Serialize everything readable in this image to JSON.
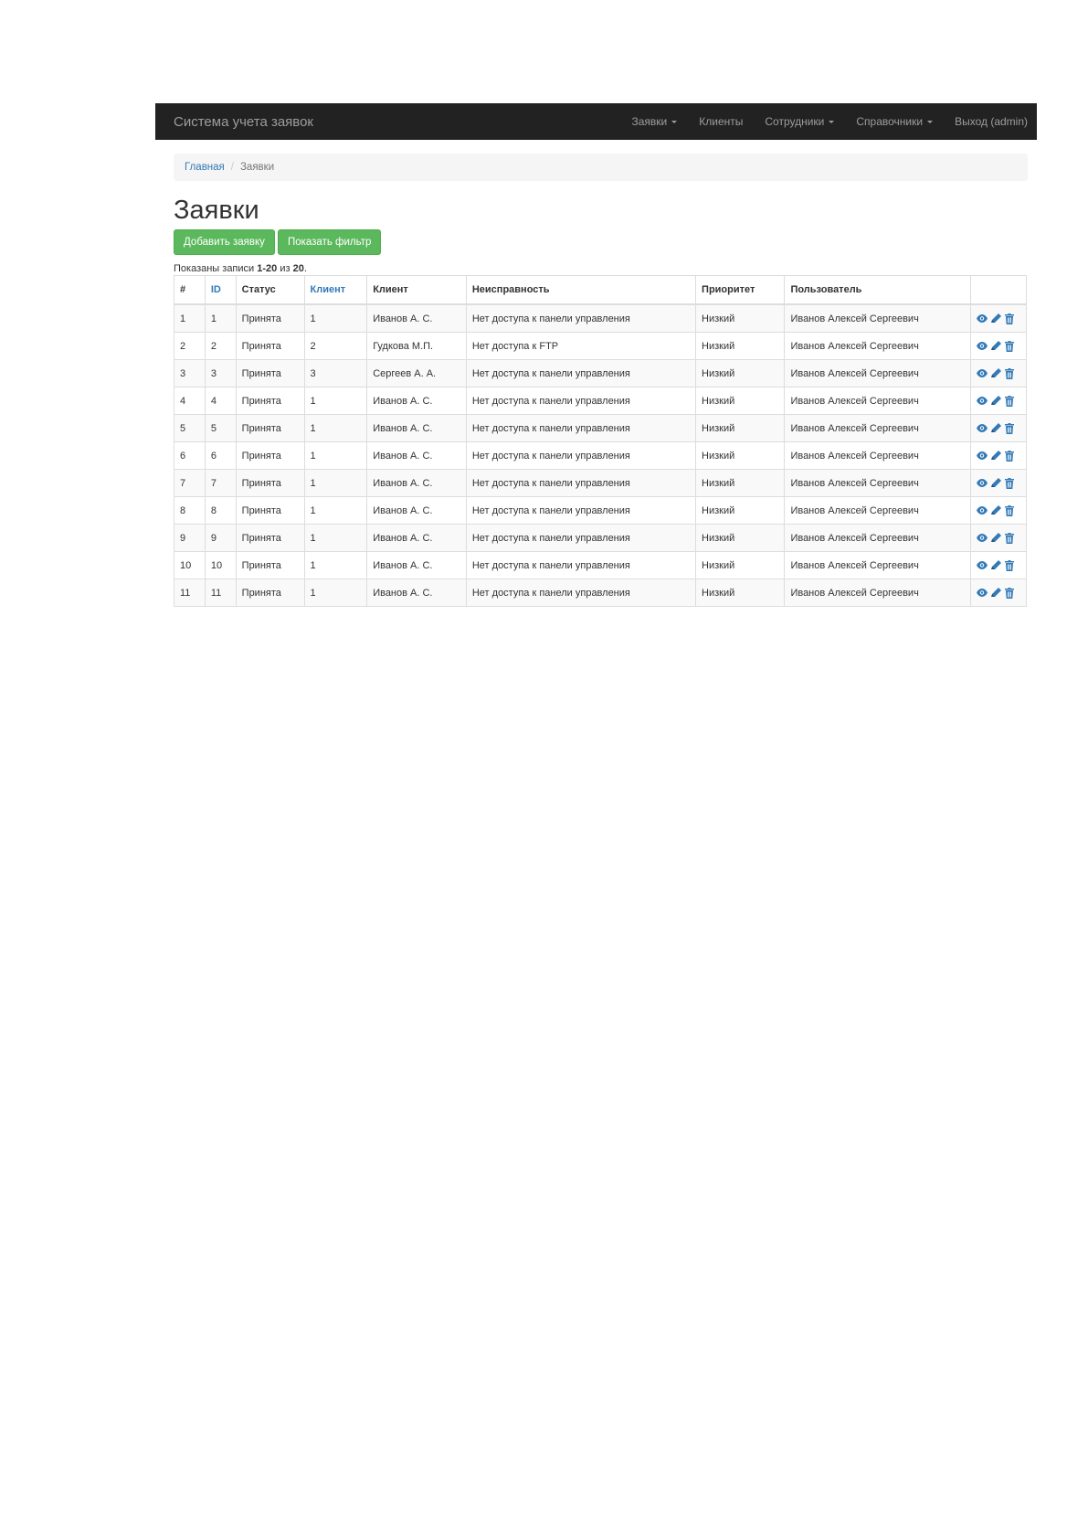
{
  "navbar": {
    "brand": "Система учета заявок",
    "items": [
      {
        "label": "Заявки",
        "dropdown": true
      },
      {
        "label": "Клиенты",
        "dropdown": false
      },
      {
        "label": "Сотрудники",
        "dropdown": true
      },
      {
        "label": "Справочники",
        "dropdown": true
      },
      {
        "label": "Выход (admin)",
        "dropdown": false
      }
    ]
  },
  "breadcrumb": {
    "home": "Главная",
    "separator": "/",
    "current": "Заявки"
  },
  "page": {
    "title": "Заявки",
    "add_button": "Добавить заявку",
    "filter_button": "Показать фильтр",
    "summary_prefix": "Показаны записи ",
    "summary_range": "1-20",
    "summary_mid": " из ",
    "summary_total": "20",
    "summary_end": "."
  },
  "table": {
    "columns": [
      {
        "label": "#",
        "sortable": false
      },
      {
        "label": "ID",
        "sortable": true
      },
      {
        "label": "Статус",
        "sortable": false
      },
      {
        "label": "Клиент",
        "sortable": true
      },
      {
        "label": "Клиент",
        "sortable": false
      },
      {
        "label": "Неисправность",
        "sortable": false
      },
      {
        "label": "Приоритет",
        "sortable": false
      },
      {
        "label": "Пользователь",
        "sortable": false
      },
      {
        "label": "",
        "sortable": false
      }
    ],
    "rows": [
      [
        "1",
        "1",
        "Принята",
        "1",
        "Иванов А. С.",
        "Нет доступа к панели управления",
        "Низкий",
        "Иванов Алексей Сергеевич"
      ],
      [
        "2",
        "2",
        "Принята",
        "2",
        "Гудкова М.П.",
        "Нет доступа к FTP",
        "Низкий",
        "Иванов Алексей Сергеевич"
      ],
      [
        "3",
        "3",
        "Принята",
        "3",
        "Сергеев А. А.",
        "Нет доступа к панели управления",
        "Низкий",
        "Иванов Алексей Сергеевич"
      ],
      [
        "4",
        "4",
        "Принята",
        "1",
        "Иванов А. С.",
        "Нет доступа к панели управления",
        "Низкий",
        "Иванов Алексей Сергеевич"
      ],
      [
        "5",
        "5",
        "Принята",
        "1",
        "Иванов А. С.",
        "Нет доступа к панели управления",
        "Низкий",
        "Иванов Алексей Сергеевич"
      ],
      [
        "6",
        "6",
        "Принята",
        "1",
        "Иванов А. С.",
        "Нет доступа к панели управления",
        "Низкий",
        "Иванов Алексей Сергеевич"
      ],
      [
        "7",
        "7",
        "Принята",
        "1",
        "Иванов А. С.",
        "Нет доступа к панели управления",
        "Низкий",
        "Иванов Алексей Сергеевич"
      ],
      [
        "8",
        "8",
        "Принята",
        "1",
        "Иванов А. С.",
        "Нет доступа к панели управления",
        "Низкий",
        "Иванов Алексей Сергеевич"
      ],
      [
        "9",
        "9",
        "Принята",
        "1",
        "Иванов А. С.",
        "Нет доступа к панели управления",
        "Низкий",
        "Иванов Алексей Сергеевич"
      ],
      [
        "10",
        "10",
        "Принята",
        "1",
        "Иванов А. С.",
        "Нет доступа к панели управления",
        "Низкий",
        "Иванов Алексей Сергеевич"
      ],
      [
        "11",
        "11",
        "Принята",
        "1",
        "Иванов А. С.",
        "Нет доступа к панели управления",
        "Низкий",
        "Иванов Алексей Сергеевич"
      ]
    ],
    "row_actions": [
      "eye-icon",
      "pencil-icon",
      "trash-icon"
    ]
  },
  "colors": {
    "navbar_bg": "#222222",
    "navbar_text": "#9d9d9d",
    "link": "#337ab7",
    "success": "#5cb85c",
    "stripe": "#f9f9f9",
    "border": "#dddddd"
  }
}
